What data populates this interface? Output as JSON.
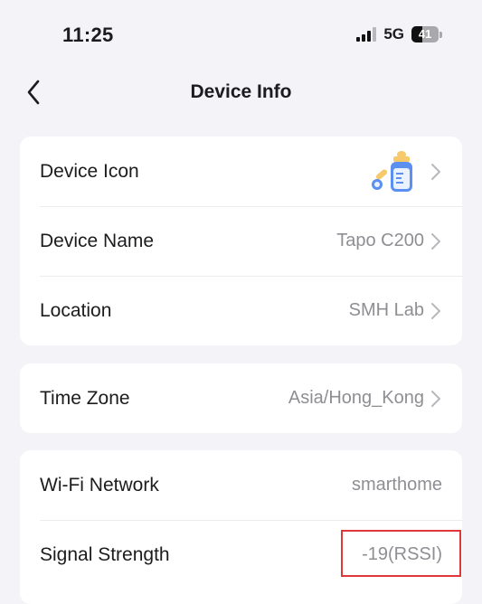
{
  "status_bar": {
    "time": "11:25",
    "network": "5G",
    "battery": "41",
    "battery_level": 0.41
  },
  "nav": {
    "title": "Device Info",
    "back_icon": "chevron-left-icon"
  },
  "device_card": {
    "rows": [
      {
        "label": "Device Icon",
        "value": "",
        "icon": "baby-bottle-icon"
      },
      {
        "label": "Device Name",
        "value": "Tapo C200"
      },
      {
        "label": "Location",
        "value": "SMH Lab"
      }
    ]
  },
  "timezone_card": {
    "rows": [
      {
        "label": "Time Zone",
        "value": "Asia/Hong_Kong"
      }
    ]
  },
  "network_card": {
    "rows": [
      {
        "label": "Wi-Fi Network",
        "value": "smarthome"
      },
      {
        "label": "Signal Strength",
        "value": "-19(RSSI)"
      }
    ]
  },
  "colors": {
    "background": "#f3f3f8",
    "card": "#ffffff",
    "secondary_text": "#8e8e93",
    "highlight": "#e0373a",
    "icon_accent": "#5b8ff0"
  }
}
